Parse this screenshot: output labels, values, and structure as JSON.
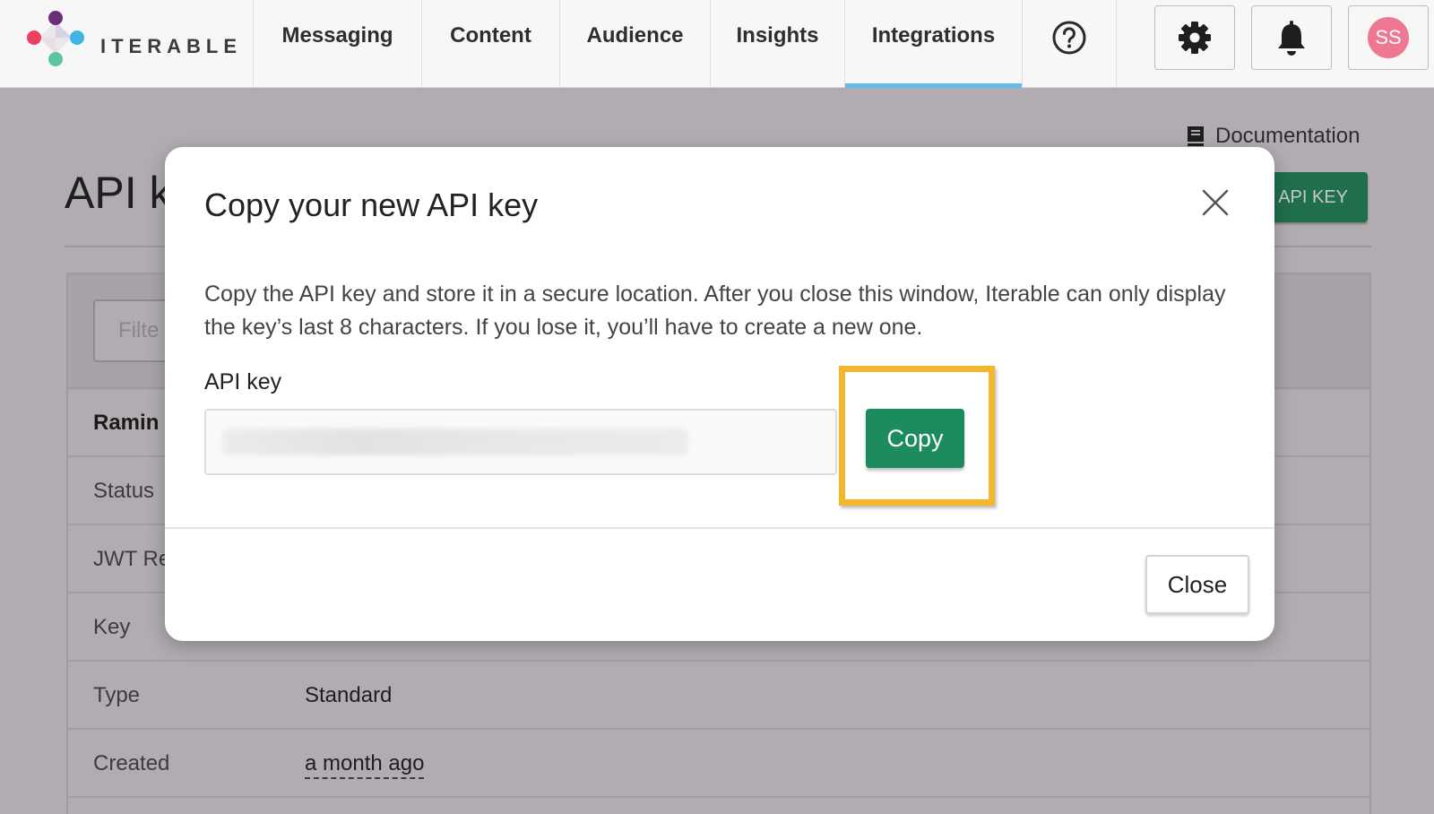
{
  "brand": {
    "name": "ITERABLE"
  },
  "nav": {
    "items": [
      {
        "label": "Messaging",
        "active": false
      },
      {
        "label": "Content",
        "active": false
      },
      {
        "label": "Audience",
        "active": false
      },
      {
        "label": "Insights",
        "active": false
      },
      {
        "label": "Integrations",
        "active": true
      }
    ],
    "help_icon": "question-circle-icon",
    "settings_icon": "gear-icon",
    "notifications_icon": "bell-icon",
    "avatar_initials": "SS"
  },
  "page": {
    "documentation_link": "Documentation",
    "title": "API k",
    "new_key_button": "API KEY",
    "filter_placeholder": "Filte",
    "rows": [
      {
        "label": "Ramin ",
        "value": ""
      },
      {
        "label": "Status",
        "value": ""
      },
      {
        "label": "JWT Re",
        "value": ""
      },
      {
        "label": "Key",
        "value": ""
      },
      {
        "label": "Type",
        "value": "Standard"
      },
      {
        "label": "Created",
        "value": "a month ago"
      }
    ]
  },
  "modal": {
    "title": "Copy your new API key",
    "description": "Copy the API key and store it in a secure location. After you close this window, Iterable can only display the key’s last 8 characters. If you lose it, you’ll have to create a new one.",
    "field_label": "API key",
    "copy_button": "Copy",
    "close_button": "Close"
  },
  "colors": {
    "accent_green": "#1c8c5f",
    "highlight_yellow": "#f3b62c",
    "active_tab": "#5fbde8",
    "avatar": "#ee7891"
  }
}
